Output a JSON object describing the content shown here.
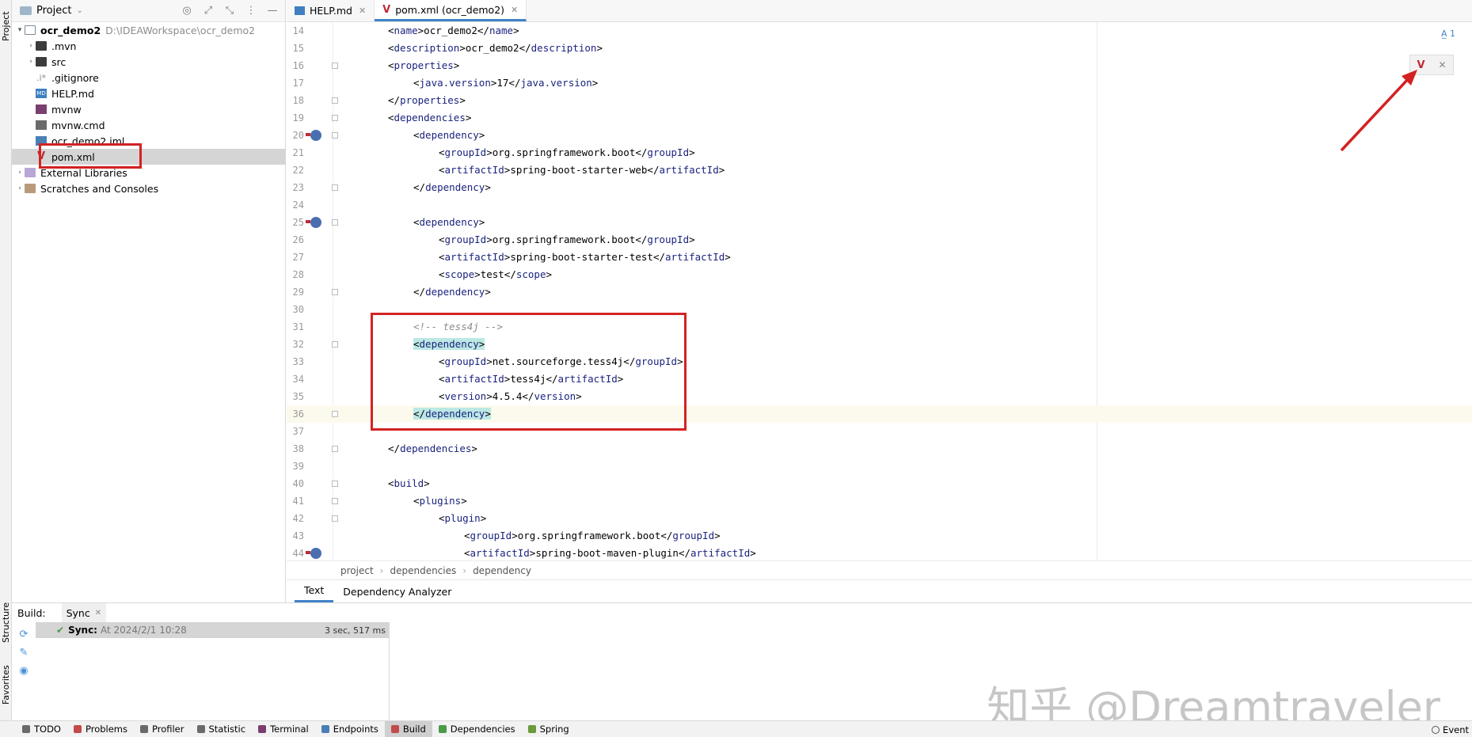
{
  "left_strip": {
    "project_label": "Project",
    "structure_label": "Structure",
    "favorites_label": "Favorites"
  },
  "project_panel": {
    "title": "Project",
    "tree": [
      {
        "label": "ocr_demo2",
        "path": "D:\\IDEAWorkspace\\ocr_demo2",
        "icon": "folder-icon",
        "expanded": true
      },
      {
        "label": ".mvn",
        "icon": "folder-icon"
      },
      {
        "label": "src",
        "icon": "folder-icon"
      },
      {
        "label": ".gitignore",
        "icon": "gitignore-file-icon"
      },
      {
        "label": "HELP.md",
        "icon": "markdown-file-icon"
      },
      {
        "label": "mvnw",
        "icon": "shell-file-icon"
      },
      {
        "label": "mvnw.cmd",
        "icon": "cmd-file-icon"
      },
      {
        "label": "ocr_demo2.iml",
        "icon": "iml-file-icon"
      },
      {
        "label": "pom.xml",
        "icon": "maven-file-icon",
        "selected": true
      },
      {
        "label": "External Libraries",
        "icon": "library-icon"
      },
      {
        "label": "Scratches and Consoles",
        "icon": "scratch-icon"
      }
    ]
  },
  "editor": {
    "tabs": [
      {
        "label": "HELP.md",
        "active": false
      },
      {
        "label": "pom.xml (ocr_demo2)",
        "active": true
      }
    ],
    "inspection_count": "1",
    "lines": [
      {
        "n": "14",
        "code": "<name>ocr_demo2</name>"
      },
      {
        "n": "15",
        "code": "<description>ocr_demo2</description>"
      },
      {
        "n": "16",
        "code": "<properties>"
      },
      {
        "n": "17",
        "code": "<java.version>17</java.version>"
      },
      {
        "n": "18",
        "code": "</properties>"
      },
      {
        "n": "19",
        "code": "<dependencies>"
      },
      {
        "n": "20",
        "code": "<dependency>"
      },
      {
        "n": "21",
        "code": "<groupId>org.springframework.boot</groupId>"
      },
      {
        "n": "22",
        "code": "<artifactId>spring-boot-starter-web</artifactId>"
      },
      {
        "n": "23",
        "code": "</dependency>"
      },
      {
        "n": "24",
        "code": ""
      },
      {
        "n": "25",
        "code": "<dependency>"
      },
      {
        "n": "26",
        "code": "<groupId>org.springframework.boot</groupId>"
      },
      {
        "n": "27",
        "code": "<artifactId>spring-boot-starter-test</artifactId>"
      },
      {
        "n": "28",
        "code": "<scope>test</scope>"
      },
      {
        "n": "29",
        "code": "</dependency>"
      },
      {
        "n": "30",
        "code": ""
      },
      {
        "n": "31",
        "code": "<!-- tess4j -->"
      },
      {
        "n": "32",
        "code": "<dependency>"
      },
      {
        "n": "33",
        "code": "<groupId>net.sourceforge.tess4j</groupId>"
      },
      {
        "n": "34",
        "code": "<artifactId>tess4j</artifactId>"
      },
      {
        "n": "35",
        "code": "<version>4.5.4</version>"
      },
      {
        "n": "36",
        "code": "</dependency>"
      },
      {
        "n": "37",
        "code": ""
      },
      {
        "n": "38",
        "code": "</dependencies>"
      },
      {
        "n": "39",
        "code": ""
      },
      {
        "n": "40",
        "code": "<build>"
      },
      {
        "n": "41",
        "code": "<plugins>"
      },
      {
        "n": "42",
        "code": "<plugin>"
      },
      {
        "n": "43",
        "code": "<groupId>org.springframework.boot</groupId>"
      },
      {
        "n": "44",
        "code": "<artifactId>spring-boot-maven-plugin</artifactId>"
      }
    ],
    "breadcrumb": [
      "project",
      "dependencies",
      "dependency"
    ],
    "bottom_tabs": [
      {
        "label": "Text",
        "active": true
      },
      {
        "label": "Dependency Analyzer",
        "active": false
      }
    ]
  },
  "build_panel": {
    "title": "Build:",
    "tab": "Sync",
    "row_title": "Sync:",
    "row_time": "At 2024/2/1 10:28",
    "row_duration": "3 sec, 517 ms",
    "watermark": "知乎 @Dreamtraveler"
  },
  "status_bar": {
    "items": [
      {
        "label": "TODO",
        "active": false
      },
      {
        "label": "Problems",
        "active": false
      },
      {
        "label": "Profiler",
        "active": false
      },
      {
        "label": "Statistic",
        "active": false
      },
      {
        "label": "Terminal",
        "active": false
      },
      {
        "label": "Endpoints",
        "active": false
      },
      {
        "label": "Build",
        "active": true
      },
      {
        "label": "Dependencies",
        "active": false
      },
      {
        "label": "Spring",
        "active": false
      }
    ],
    "event_log": "Event"
  },
  "colors": {
    "annotation_red": "#d32222",
    "xml_tag": "#1a237e",
    "selection_teal": "#bce8e4",
    "maven_red": "#c02a36",
    "active_tab_blue": "#4083c9"
  }
}
